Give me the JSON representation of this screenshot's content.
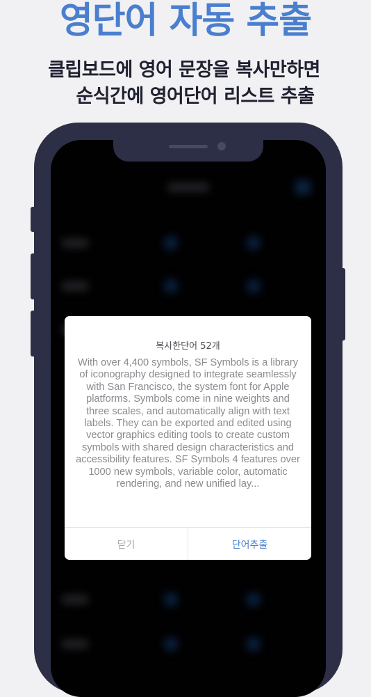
{
  "colors": {
    "accent": "#4a7fcf",
    "phone_frame": "#2c2f45",
    "background": "#f1f1f3"
  },
  "promo": {
    "headline": "영단어 자동 추출",
    "subhead_line1": "클립보드에 영어 문장을 복사만하면",
    "subhead_line2": "순식간에 영어단어 리스트 추출"
  },
  "modal": {
    "title": "복사한단어 52개",
    "body": "With over 4,400 symbols, SF Symbols is a library of iconography designed to integrate seamlessly with San Francisco, the system font for Apple platforms. Symbols come in nine weights and three scales, and automatically align with text labels. They can be exported and edited using vector graphics editing tools to create custom symbols with shared design characteristics and accessibility features. SF Symbols 4 features over 1000 new symbols, variable color, automatic rendering, and new unified lay...",
    "close_label": "닫기",
    "extract_label": "단어추출"
  }
}
